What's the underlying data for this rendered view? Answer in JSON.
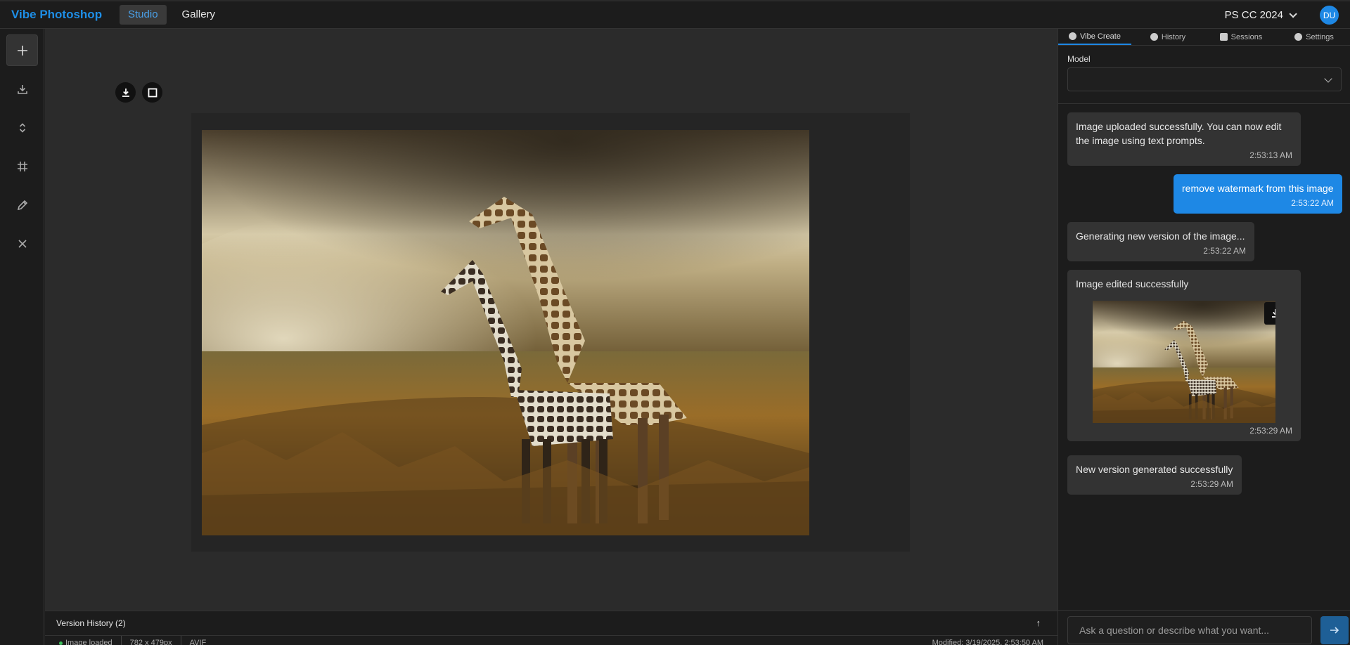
{
  "app": {
    "brand": "Vibe Photoshop",
    "avatar_initials": "DU",
    "version": "PS CC 2024",
    "accent": "#1e88e5"
  },
  "nav": {
    "tabs": [
      {
        "label": "Studio",
        "active": true
      },
      {
        "label": "Gallery",
        "active": false
      }
    ]
  },
  "toolbar": {
    "tools": [
      "plus-icon",
      "download-icon",
      "expand-vertical-icon",
      "crop-icon",
      "pencil-icon",
      "close-icon"
    ]
  },
  "version_history": {
    "label": "Version History (2)",
    "arrow": "↑"
  },
  "status": {
    "state": "Image loaded",
    "dimensions": "782 x 479px",
    "format": "AVIF",
    "modified": "Modified: 3/19/2025, 2:53:50 AM"
  },
  "panel": {
    "tabs": [
      {
        "label": "Vibe Create",
        "active": true,
        "icon": "plus-circle-icon"
      },
      {
        "label": "History",
        "active": false,
        "icon": "clock-icon"
      },
      {
        "label": "Sessions",
        "active": false,
        "icon": "folder-icon"
      },
      {
        "label": "Settings",
        "active": false,
        "icon": "gear-icon"
      }
    ],
    "model_label": "Model",
    "model_value": ""
  },
  "chat": {
    "messages": [
      {
        "role": "assistant",
        "text": "Image uploaded successfully. You can now edit the image using text prompts.",
        "time": "2:53:13 AM"
      },
      {
        "role": "user",
        "text": "remove watermark from this image",
        "time": "2:53:22 AM"
      },
      {
        "role": "assistant",
        "text": "Generating new version of the image...",
        "time": "2:53:22 AM"
      },
      {
        "role": "assistant",
        "text": "Image edited successfully",
        "time": "2:53:29 AM",
        "has_image": true
      },
      {
        "role": "assistant",
        "text": "New version generated successfully",
        "time": "2:53:29 AM"
      }
    ],
    "input_placeholder": "Ask a question or describe what you want..."
  }
}
